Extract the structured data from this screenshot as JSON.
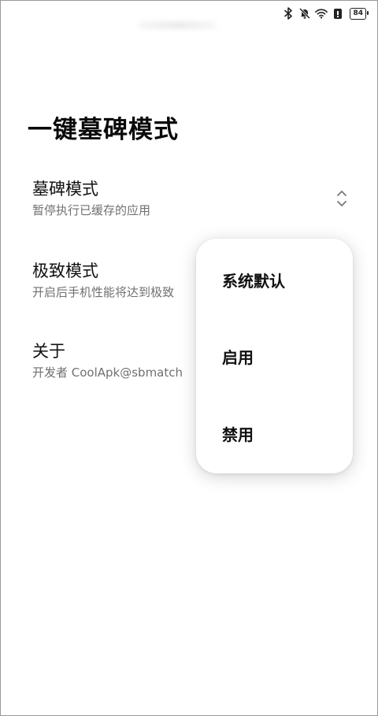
{
  "page": {
    "title": "一键墓碑模式"
  },
  "status_bar": {
    "battery_level": "84",
    "icons": [
      "bluetooth-icon",
      "mute-bell-icon",
      "wifi-icon",
      "battery-saver-icon",
      "battery-icon"
    ]
  },
  "preferences": [
    {
      "title": "墓碑模式",
      "summary": "暂停执行已缓存的应用"
    },
    {
      "title": "极致模式",
      "summary": "开启后手机性能将达到极致"
    },
    {
      "title": "关于",
      "summary": "开发者 CoolApk@sbmatch"
    }
  ],
  "popup_menu": {
    "options": [
      "系统默认",
      "启用",
      "禁用"
    ]
  }
}
